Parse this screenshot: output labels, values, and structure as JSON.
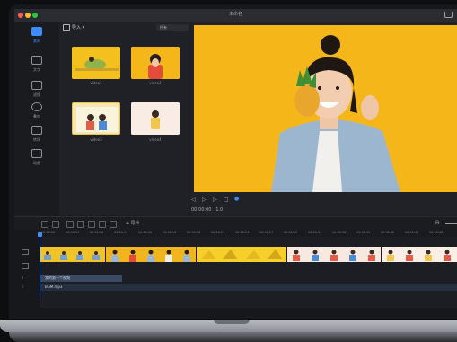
{
  "window": {
    "title": "未命名"
  },
  "colors": {
    "accent": "#3d8cff",
    "video_bg": "#f5b619",
    "traffic_red": "#ff5f57",
    "traffic_yellow": "#febc2e",
    "traffic_green": "#28c840"
  },
  "sidebar": {
    "items": [
      {
        "label": "素材",
        "icon": "media-icon",
        "active": true
      },
      {
        "label": "文字",
        "icon": "text-icon",
        "active": false
      },
      {
        "label": "滤镜",
        "icon": "filter-icon",
        "active": false
      },
      {
        "label": "叠加",
        "icon": "overlay-icon",
        "active": false
      },
      {
        "label": "转场",
        "icon": "transition-icon",
        "active": false
      },
      {
        "label": "动画",
        "icon": "animation-icon",
        "active": false
      }
    ]
  },
  "media": {
    "import_label": "导入",
    "filter_label": "所有",
    "thumbnails": [
      {
        "label": "video1",
        "icon": "video-thumbnail"
      },
      {
        "label": "video2",
        "icon": "video-thumbnail"
      },
      {
        "label": "video3",
        "icon": "video-thumbnail"
      },
      {
        "label": "video4",
        "icon": "video-thumbnail"
      }
    ]
  },
  "preview": {
    "timecode_label": "00:00:00",
    "speed_value": "1.0"
  },
  "timeline": {
    "export_label": "导出",
    "ruler_ticks": [
      "00:00:00",
      "00:00:03",
      "00:00:06",
      "00:00:09",
      "00:00:12",
      "00:00:15",
      "00:00:18",
      "00:00:21",
      "00:00:24",
      "00:00:27",
      "00:00:30",
      "00:00:33",
      "00:00:36",
      "00:00:39",
      "00:00:42",
      "00:00:45",
      "00:00:48"
    ],
    "text_track_label": "我的第一个视频",
    "audio_track_label": "BGM.mp3"
  }
}
